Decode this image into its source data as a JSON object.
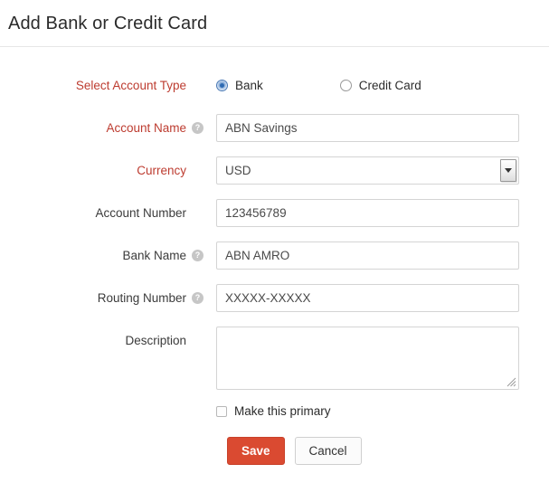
{
  "header": {
    "title": "Add Bank or Credit Card"
  },
  "form": {
    "account_type": {
      "label": "Select Account Type",
      "options": [
        {
          "label": "Bank",
          "selected": true
        },
        {
          "label": "Credit Card",
          "selected": false
        }
      ]
    },
    "account_name": {
      "label": "Account Name",
      "value": "ABN Savings",
      "help_icon": "question-mark-icon"
    },
    "currency": {
      "label": "Currency",
      "value": "USD"
    },
    "account_number": {
      "label": "Account Number",
      "value": "123456789"
    },
    "bank_name": {
      "label": "Bank Name",
      "value": "ABN AMRO",
      "help_icon": "question-mark-icon"
    },
    "routing_number": {
      "label": "Routing Number",
      "value": "XXXXX-XXXXX",
      "help_icon": "question-mark-icon"
    },
    "description": {
      "label": "Description",
      "value": ""
    },
    "make_primary": {
      "label": "Make this primary",
      "checked": false
    }
  },
  "actions": {
    "save_label": "Save",
    "cancel_label": "Cancel"
  },
  "colors": {
    "required_label": "#bd3c30",
    "save_button": "#da4a31",
    "radio_selected": "#2f6bb3",
    "border": "#d4d4d4"
  },
  "help_mark": "?"
}
